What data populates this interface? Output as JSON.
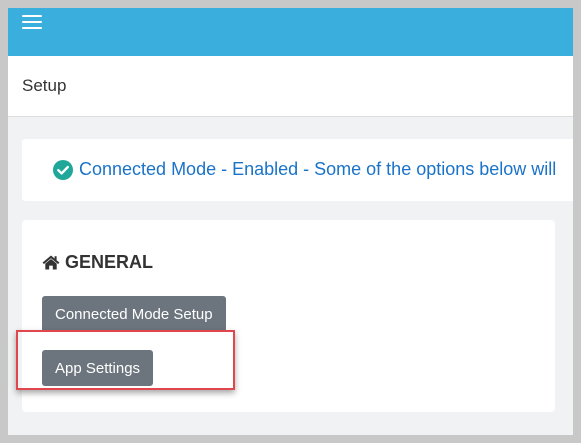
{
  "header": {
    "menu_icon": "hamburger-icon"
  },
  "subheader": {
    "title": "Setup"
  },
  "alert": {
    "icon": "check-circle-icon",
    "message": "Connected Mode - Enabled - Some of the options below will"
  },
  "general": {
    "icon": "home-icon",
    "heading": "GENERAL",
    "buttons": [
      {
        "label": "Connected Mode Setup"
      },
      {
        "label": "App Settings"
      }
    ]
  },
  "colors": {
    "topbar": "#3aafdd",
    "alert_text": "#1a73c8",
    "check_icon": "#1fa79a",
    "button_bg": "#6c757d",
    "highlight": "#e0464b"
  }
}
